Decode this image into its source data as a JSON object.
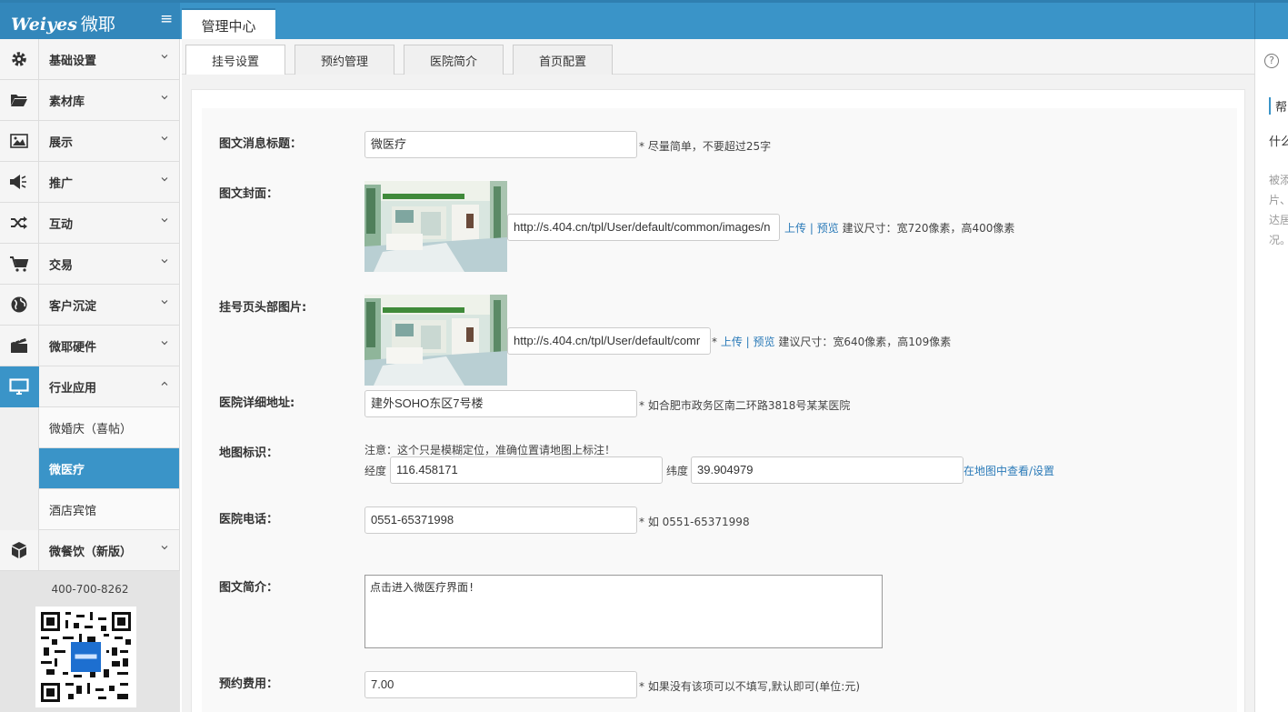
{
  "header": {
    "logo_latin": "Weiyes",
    "logo_cn": "微耶",
    "main_tab": "管理中心"
  },
  "sidebar": {
    "items": [
      {
        "label": "基础设置",
        "icon": "gear-icon"
      },
      {
        "label": "素材库",
        "icon": "folder-icon"
      },
      {
        "label": "展示",
        "icon": "image-icon"
      },
      {
        "label": "推广",
        "icon": "megaphone-icon"
      },
      {
        "label": "互动",
        "icon": "shuffle-icon"
      },
      {
        "label": "交易",
        "icon": "cart-icon"
      },
      {
        "label": "客户沉淀",
        "icon": "globe-icon"
      },
      {
        "label": "微耶硬件",
        "icon": "clapper-icon"
      },
      {
        "label": "行业应用",
        "icon": "monitor-icon"
      }
    ],
    "sub_items": [
      "微婚庆（喜帖）",
      "微医疗",
      "酒店宾馆"
    ],
    "after_item": {
      "label": "微餐饮（新版）",
      "icon": "cube-icon"
    },
    "phone": "400-700-8262"
  },
  "subtabs": [
    "挂号设置",
    "预约管理",
    "医院简介",
    "首页配置"
  ],
  "form": {
    "title_label": "图文消息标题：",
    "title_value": "微医疗",
    "title_hint": "* 尽量简单，不要超过25字",
    "cover_label": "图文封面：",
    "cover_url": "http://s.404.cn/tpl/User/default/common/images/n",
    "cover_upload": "上传",
    "cover_sep": "|",
    "cover_preview": "预览",
    "cover_hint": "建议尺寸：宽720像素，高400像素",
    "header_img_label": "挂号页头部图片:",
    "header_img_url": "http://s.404.cn/tpl/User/default/comr",
    "header_img_star": "*",
    "header_img_upload": "上传",
    "header_img_sep": "|",
    "header_img_preview": "预览",
    "header_img_hint": "建议尺寸：宽640像素，高109像素",
    "address_label": "医院详细地址:",
    "address_value": "建外SOHO东区7号楼",
    "address_hint": "* 如合肥市政务区南二环路3818号某某医院",
    "map_label": "地图标识：",
    "map_note": "注意：这个只是模糊定位，准确位置请地图上标注！",
    "lng_label": "经度",
    "lng_value": "116.458171",
    "lat_label": "纬度",
    "lat_value": "39.904979",
    "map_link": "在地图中查看/设置",
    "phone_label": "医院电话：",
    "phone_value": "0551-65371998",
    "phone_hint": "* 如 0551-65371998",
    "intro_label": "图文简介：",
    "intro_value": "点击进入微医疗界面!",
    "fee_label": "预约费用：",
    "fee_value": "7.00",
    "fee_hint": "* 如果没有该项可以不填写,默认即可(单位:元)"
  },
  "right_panel": {
    "lines": [
      "帮",
      "什么",
      "被添",
      "片、",
      "达居",
      "况。"
    ]
  }
}
